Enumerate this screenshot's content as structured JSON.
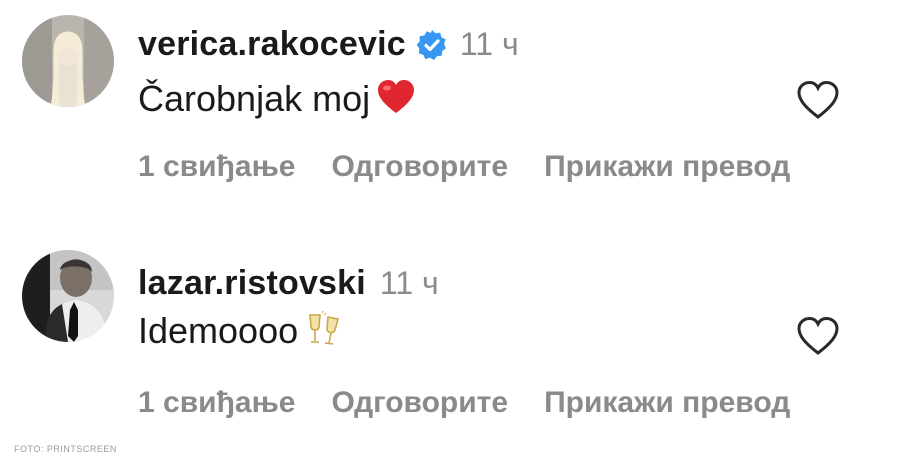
{
  "comments": [
    {
      "username": "verica.rakocevic",
      "verified": true,
      "time": "11 ч",
      "text": "Čarobnjak moj",
      "emoji": "red-heart",
      "likes": "1 свиђање",
      "reply": "Одговорите",
      "translate": "Прикажи превод"
    },
    {
      "username": "lazar.ristovski",
      "verified": false,
      "time": "11 ч",
      "text": "Idemoooo",
      "emoji": "clinking-glasses",
      "likes": "1 свиђање",
      "reply": "Одговорите",
      "translate": "Прикажи превод"
    }
  ],
  "credit": "FOTO: PRINTSCREEN",
  "colors": {
    "verified_badge": "#3897f0",
    "heart_emoji": "#e0262e",
    "secondary_text": "#8a8a8a"
  }
}
